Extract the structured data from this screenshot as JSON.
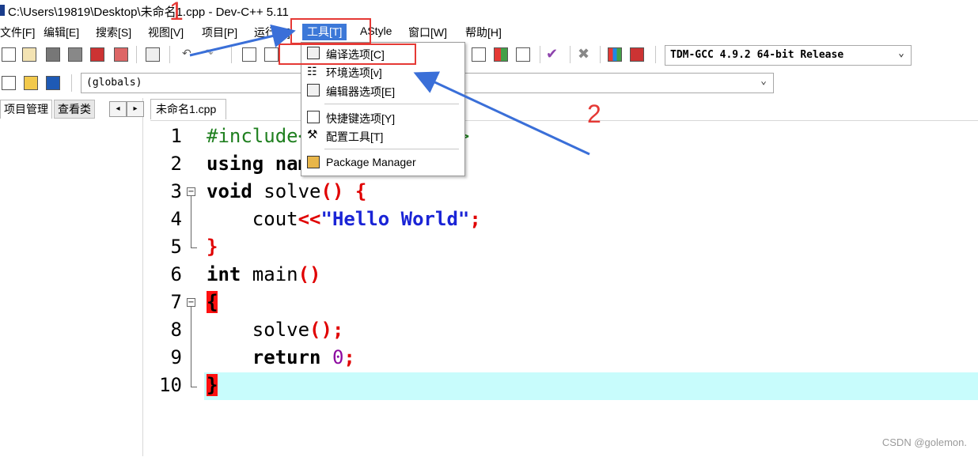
{
  "window": {
    "title": "C:\\Users\\19819\\Desktop\\未命名1.cpp - Dev-C++ 5.11"
  },
  "menubar": {
    "items": [
      "文件[F]",
      "编辑[E]",
      "搜索[S]",
      "视图[V]",
      "项目[P]",
      "运行[R]",
      "工具[T]",
      "AStyle",
      "窗口[W]",
      "帮助[H]"
    ]
  },
  "toolbar": {
    "compiler_select": "TDM-GCC 4.9.2 64-bit Release",
    "scope_select": "(globals)"
  },
  "left_panel": {
    "tabs": [
      "项目管理",
      "查看类"
    ],
    "scroll_left": "◂",
    "scroll_right": "▸"
  },
  "editor": {
    "tab_label": "未命名1.cpp",
    "line_numbers": [
      "1",
      "2",
      "3",
      "4",
      "5",
      "6",
      "7",
      "8",
      "9",
      "10"
    ]
  },
  "tools_menu": {
    "items": [
      "编译选项[C]",
      "环境选项[v]",
      "编辑器选项[E]",
      "快捷键选项[Y]",
      "配置工具[T]",
      "Package Manager"
    ]
  },
  "annotations": {
    "label_1": "1",
    "label_2": "2"
  },
  "watermark": "CSDN @golemon.",
  "colors": {
    "annotation_red": "#e53935",
    "arrow_blue": "#3a6fd8",
    "current_line": "#c8fcfc"
  }
}
